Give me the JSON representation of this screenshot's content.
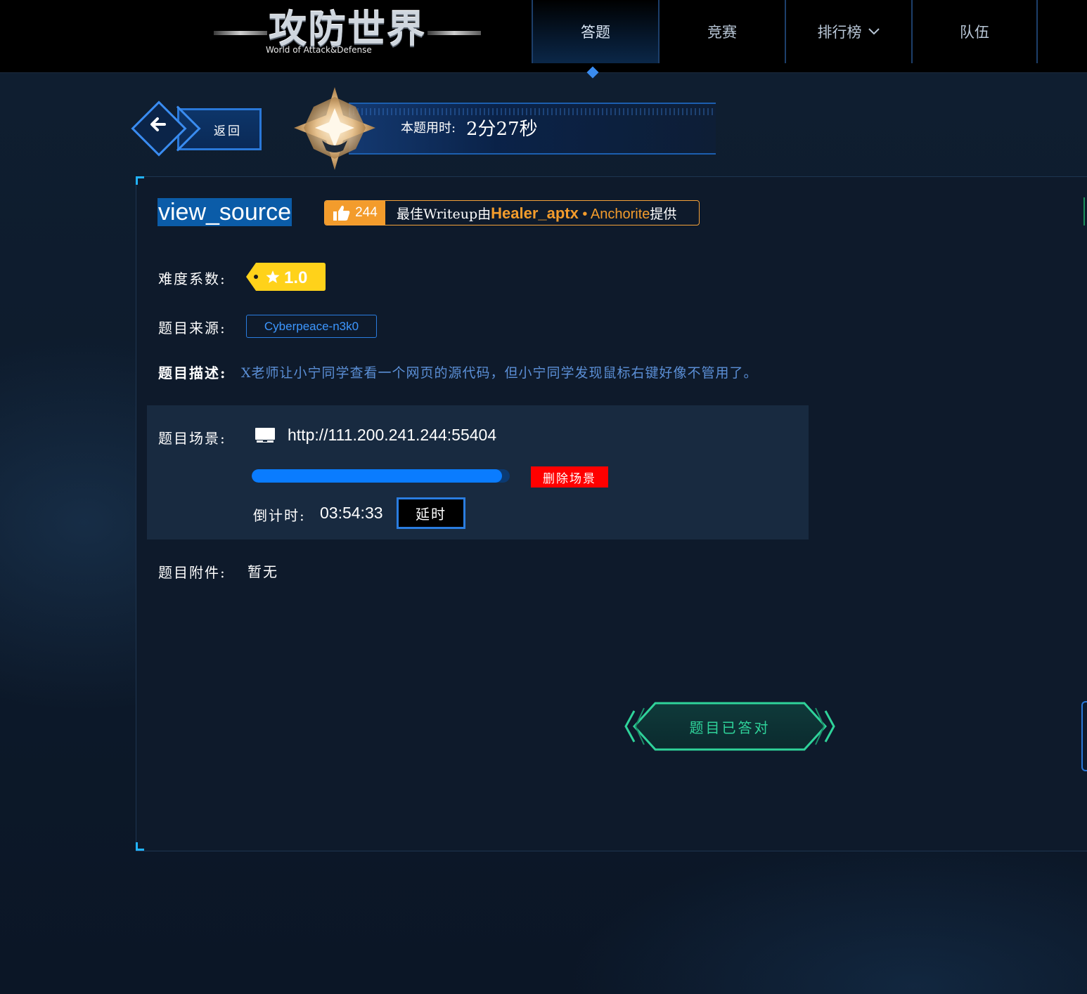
{
  "header": {
    "logo_title": "攻防世界",
    "logo_subtitle": "World of Attack&Defense",
    "nav": [
      {
        "label": "答题",
        "active": true
      },
      {
        "label": "竞赛",
        "active": false
      },
      {
        "label": "排行榜",
        "active": false,
        "has_dropdown": true
      },
      {
        "label": "队伍",
        "active": false
      }
    ]
  },
  "back": {
    "label": "返回"
  },
  "timer": {
    "label": "本题用时:",
    "value": "2分27秒"
  },
  "problem": {
    "title": "view_source",
    "writeup": {
      "likes": "244",
      "prefix": "最佳Writeup由",
      "author": "Healer_aptx",
      "separator": " • ",
      "team": "Anchorite",
      "suffix": "提供"
    },
    "difficulty_label": "难度系数:",
    "difficulty_value": "1.0",
    "source_label": "题目来源:",
    "source_value": "Cyberpeace-n3k0",
    "desc_label": "题目描述:",
    "desc_value": "X老师让小宁同学查看一个网页的源代码，但小宁同学发现鼠标右键好像不管用了。",
    "scene_label": "题目场景:",
    "scene_url": "http://111.200.241.244:55404",
    "scene_progress": 0.97,
    "delete_label": "删除场景",
    "countdown_label": "倒计时:",
    "countdown_value": "03:54:33",
    "extend_label": "延时",
    "attach_label": "题目附件:",
    "attach_value": "暂无",
    "solved_label": "题目已答对"
  },
  "colors": {
    "accent": "#0a7cff",
    "writeup": "#f39c2c",
    "danger": "#ff0000",
    "success": "#2fd39a",
    "difficulty": "#ffd21a"
  }
}
